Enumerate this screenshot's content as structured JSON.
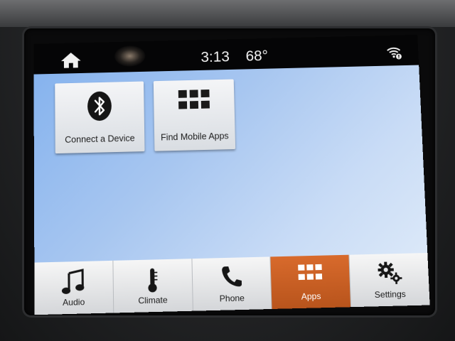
{
  "status_bar": {
    "time": "3:13",
    "temperature": "68°",
    "icons": [
      "home-icon",
      "wifi-icon"
    ]
  },
  "tiles": [
    {
      "label": "Connect a Device",
      "icon": "bluetooth-icon"
    },
    {
      "label": "Find Mobile Apps",
      "icon": "grid-icon"
    }
  ],
  "dock": {
    "items": [
      {
        "label": "Audio",
        "icon": "music-note-icon"
      },
      {
        "label": "Climate",
        "icon": "thermometer-icon"
      },
      {
        "label": "Phone",
        "icon": "phone-icon"
      },
      {
        "label": "Apps",
        "icon": "grid-icon",
        "active": true
      },
      {
        "label": "Settings",
        "icon": "gears-icon"
      }
    ]
  },
  "colors": {
    "active_tab": "#c75f24",
    "background_blue": "#a7c6f0",
    "status_bar": "#050506"
  }
}
